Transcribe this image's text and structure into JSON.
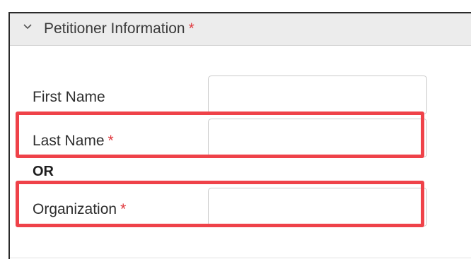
{
  "section": {
    "title": "Petitioner Information",
    "required_marker": "*",
    "icon": "chevron-down-icon"
  },
  "fields": {
    "first_name": {
      "label": "First Name",
      "value": ""
    },
    "last_name": {
      "label": "Last Name",
      "required_marker": "*",
      "value": ""
    },
    "or_label": "OR",
    "organization": {
      "label": "Organization",
      "required_marker": "*",
      "value": ""
    }
  },
  "colors": {
    "required": "#e0393e",
    "highlight_border": "#ef4249",
    "header_background": "#ececec"
  }
}
